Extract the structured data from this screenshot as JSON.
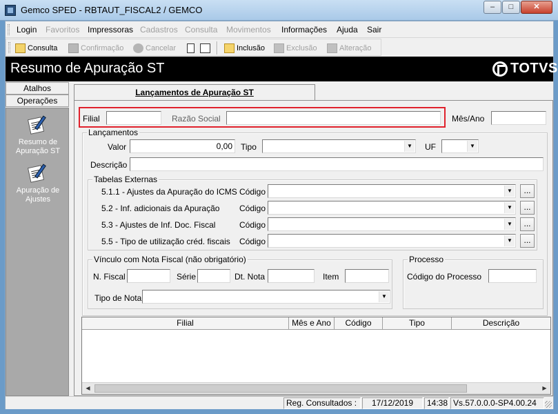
{
  "window": {
    "title": "Gemco SPED - RBTAUT_FISCAL2 / GEMCO",
    "minimize_glyph": "–",
    "maximize_glyph": "□",
    "close_glyph": "✕"
  },
  "menubar": {
    "items": [
      {
        "label": "Login",
        "enabled": true
      },
      {
        "label": "Favoritos",
        "enabled": false
      },
      {
        "label": "Impressoras",
        "enabled": true
      },
      {
        "label": "Cadastros",
        "enabled": false
      },
      {
        "label": "Consulta",
        "enabled": false
      },
      {
        "label": "Movimentos",
        "enabled": false
      },
      {
        "label": "Informações",
        "enabled": true
      },
      {
        "label": "Ajuda",
        "enabled": true
      },
      {
        "label": "Sair",
        "enabled": true
      }
    ]
  },
  "toolbar": {
    "consulta": "Consulta",
    "confirmacao": "Confirmação",
    "cancelar": "Cancelar",
    "inclusao": "Inclusão",
    "exclusao": "Exclusão",
    "alteracao": "Alteração"
  },
  "banner": {
    "title": "Resumo de Apuração ST",
    "logo_text": "TOTVS"
  },
  "sidebar": {
    "tabs": [
      "Atalhos",
      "Operações"
    ],
    "items": [
      {
        "label_line1": "Resumo de",
        "label_line2": "Apuração ST",
        "icon": "document-pen-icon"
      },
      {
        "label_line1": "Apuração de",
        "label_line2": "Ajustes",
        "icon": "document-pen-icon"
      }
    ]
  },
  "main": {
    "tab_label": "Lançamentos de Apuração ST",
    "filial": {
      "label": "Filial",
      "value": ""
    },
    "razao_social": {
      "label": "Razão Social",
      "value": ""
    },
    "mes_ano": {
      "label": "Mês/Ano",
      "value": ""
    },
    "lancamentos": {
      "title": "Lançamentos",
      "valor_label": "Valor",
      "valor_value": "0,00",
      "tipo_label": "Tipo",
      "tipo_value": "",
      "uf_label": "UF",
      "uf_value": "",
      "descricao_label": "Descrição",
      "descricao_value": ""
    },
    "tabelas_externas": {
      "title": "Tabelas Externas",
      "codigo_label": "Código",
      "browse_label": "...",
      "rows": [
        {
          "label": "5.1.1 - Ajustes da Apuração do ICMS",
          "value": ""
        },
        {
          "label": "5.2 - Inf. adicionais da Apuração",
          "value": ""
        },
        {
          "label": "5.3 - Ajustes de Inf. Doc. Fiscal",
          "value": ""
        },
        {
          "label": "5.5 - Tipo de utilização créd. fiscais",
          "value": ""
        }
      ]
    },
    "vinculo": {
      "title": "Vínculo com Nota Fiscal (não obrigatório)",
      "nfiscal_label": "N. Fiscal",
      "serie_label": "Série",
      "dtnota_label": "Dt. Nota",
      "item_label": "Item",
      "tiponota_label": "Tipo de Nota"
    },
    "processo": {
      "title": "Processo",
      "codigo_label": "Código do Processo",
      "codigo_value": ""
    },
    "grid": {
      "columns": [
        "Filial",
        "Mês e Ano",
        "Código",
        "Tipo",
        "Descrição"
      ],
      "rows": []
    }
  },
  "statusbar": {
    "reg_label": "Reg. Consultados :",
    "reg_value": "",
    "date": "17/12/2019",
    "time": "14:38",
    "version": "Vs.57.0.0.0-SP4.00.24"
  },
  "colors": {
    "banner_bg": "#000000",
    "highlight_border": "#e0202b",
    "sidebar_panel": "#a9a9a9"
  }
}
